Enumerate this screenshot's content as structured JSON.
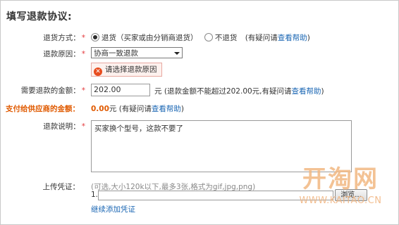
{
  "title": "填写退款协议:",
  "return_method": {
    "label": "退货方式：",
    "option_return": "退货（买家或由分销商退货）",
    "option_no_return": "不退货",
    "help_prefix": "(有疑问请",
    "help_link": "查看帮助",
    "help_suffix": ")"
  },
  "refund_reason": {
    "label": "退款原因：",
    "selected": "协商一致退款",
    "error": "请选择退款原因"
  },
  "refund_amount": {
    "label": "需要退款的金额：",
    "value": "202.00",
    "unit": "元",
    "note_prefix": "(退款金额不能超过202.00元,有疑问请",
    "help_link": "查看帮助",
    "note_suffix": ")"
  },
  "supplier_amount": {
    "label": "支付给供应商的金额：",
    "value": "0.00",
    "unit": "元",
    "note_prefix": "(有疑问请",
    "help_link": "查看帮助",
    "note_suffix": ")"
  },
  "description": {
    "label": "退款说明：",
    "value": "买家换个型号，这款不要了"
  },
  "upload": {
    "label": "上传凭证：",
    "hint": "(可选,大小120k以下,最多3张,格式为gif,jpg,png)",
    "index": "1.",
    "browse": "浏览...",
    "add_more": "继续添加凭证"
  },
  "required_mark": "*",
  "watermark": {
    "logo": "开淘网",
    "url": "WWW.KAITAO.CN"
  }
}
